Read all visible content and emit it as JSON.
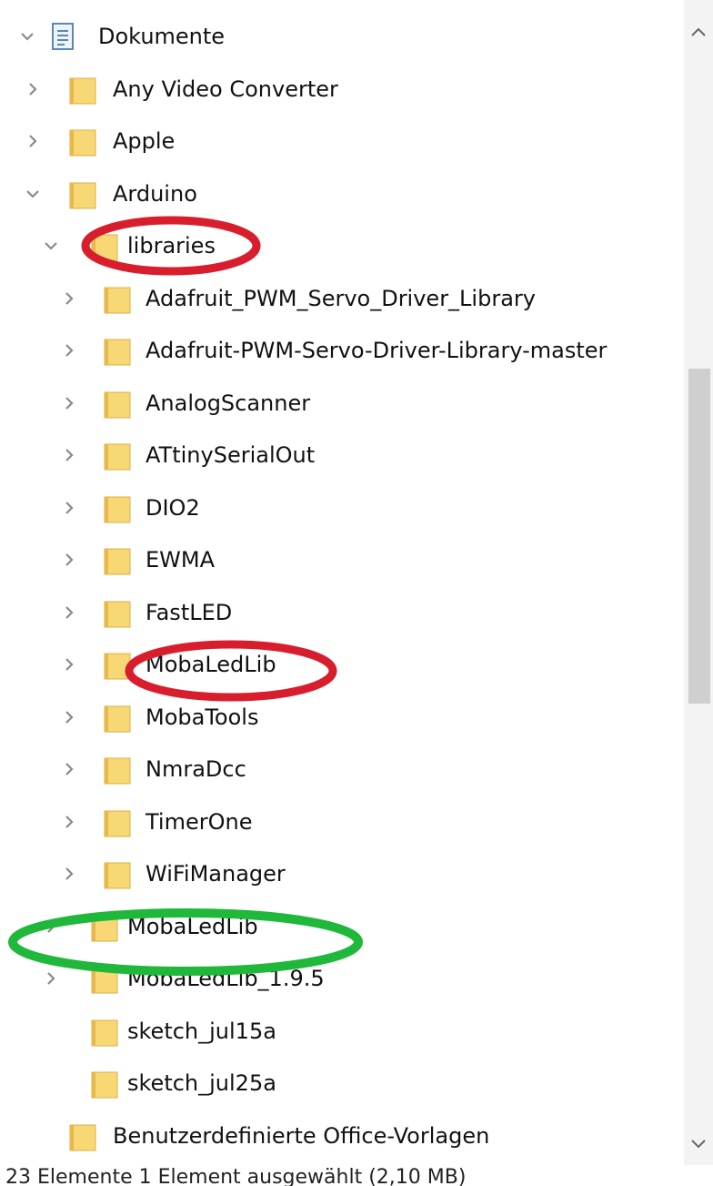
{
  "tree": [
    {
      "label": "Dokumente",
      "level": 0,
      "chevron": "expanded",
      "icon": "document-library-icon"
    },
    {
      "label": "Any Video Converter",
      "level": 1,
      "chevron": "collapsed",
      "icon": "folder-icon"
    },
    {
      "label": "Apple",
      "level": 1,
      "chevron": "collapsed",
      "icon": "folder-icon"
    },
    {
      "label": "Arduino",
      "level": 1,
      "chevron": "expanded",
      "icon": "folder-icon"
    },
    {
      "label": "libraries",
      "level": 2,
      "chevron": "expanded",
      "icon": "folder-icon"
    },
    {
      "label": "Adafruit_PWM_Servo_Driver_Library",
      "level": 3,
      "chevron": "collapsed",
      "icon": "folder-icon"
    },
    {
      "label": "Adafruit-PWM-Servo-Driver-Library-master",
      "level": 3,
      "chevron": "collapsed",
      "icon": "folder-icon"
    },
    {
      "label": "AnalogScanner",
      "level": 3,
      "chevron": "collapsed",
      "icon": "folder-icon"
    },
    {
      "label": "ATtinySerialOut",
      "level": 3,
      "chevron": "collapsed",
      "icon": "folder-icon"
    },
    {
      "label": "DIO2",
      "level": 3,
      "chevron": "collapsed",
      "icon": "folder-icon"
    },
    {
      "label": "EWMA",
      "level": 3,
      "chevron": "collapsed",
      "icon": "folder-icon"
    },
    {
      "label": "FastLED",
      "level": 3,
      "chevron": "collapsed",
      "icon": "folder-icon"
    },
    {
      "label": "MobaLedLib",
      "level": 3,
      "chevron": "collapsed",
      "icon": "folder-icon"
    },
    {
      "label": "MobaTools",
      "level": 3,
      "chevron": "collapsed",
      "icon": "folder-icon"
    },
    {
      "label": "NmraDcc",
      "level": 3,
      "chevron": "collapsed",
      "icon": "folder-icon"
    },
    {
      "label": "TimerOne",
      "level": 3,
      "chevron": "collapsed",
      "icon": "folder-icon"
    },
    {
      "label": "WiFiManager",
      "level": 3,
      "chevron": "collapsed",
      "icon": "folder-icon"
    },
    {
      "label": "MobaLedLib",
      "level": 2,
      "chevron": "collapsed",
      "icon": "folder-icon"
    },
    {
      "label": "MobaLedLib_1.9.5",
      "level": 2,
      "chevron": "collapsed",
      "icon": "folder-icon"
    },
    {
      "label": "sketch_jul15a",
      "level": 2,
      "chevron": "none",
      "icon": "folder-icon"
    },
    {
      "label": "sketch_jul25a",
      "level": 2,
      "chevron": "none",
      "icon": "folder-icon"
    },
    {
      "label": "Benutzerdefinierte Office-Vorlagen",
      "level": 1,
      "chevron": "none",
      "icon": "folder-icon"
    }
  ],
  "status_text": "23 Elemente   1 Element ausgewählt (2,10 MB)",
  "colors": {
    "folder_fill": "#f8d775",
    "folder_tab": "#e8b94a",
    "chevron": "#8a8a8a",
    "highlight_red": "#d81e2c",
    "highlight_green": "#1fb83a",
    "scroll_thumb": "#cfcfcf"
  },
  "annotations": [
    {
      "name": "libraries-red-highlight",
      "color": "red",
      "target": "libraries"
    },
    {
      "name": "mobaledlib-red-highlight",
      "color": "red",
      "target": "MobaLedLib"
    },
    {
      "name": "mobaledlib-green-highlight",
      "color": "green",
      "target": "MobaLedLib"
    }
  ]
}
